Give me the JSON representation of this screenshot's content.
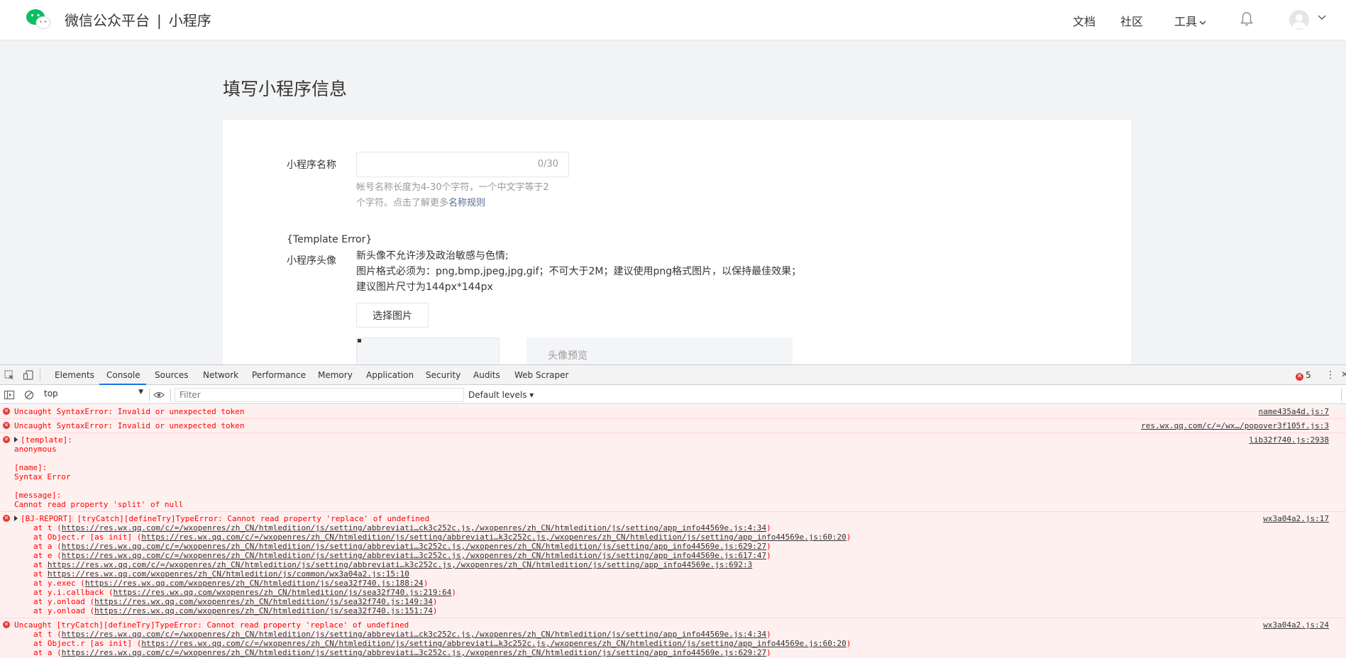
{
  "header": {
    "brand": "微信公众平台",
    "separator": "|",
    "product": "小程序",
    "nav": [
      "文档",
      "社区",
      "工具"
    ],
    "brand_color": "#07c160"
  },
  "page": {
    "title": "填写小程序信息",
    "name_field": {
      "label": "小程序名称",
      "value": "",
      "counter": "0/30",
      "tip_line1": "帐号名称长度为4-30个字符，一个中文字等于2",
      "tip_line2": "个字符。点击了解更多",
      "tip_link": "名称规则"
    },
    "template_error": "{Template Error}",
    "avatar_field": {
      "label": "小程序头像",
      "desc": [
        "新头像不允许涉及政治敏感与色情;",
        "图片格式必须为：png,bmp,jpeg,jpg,gif；不可大于2M；建议使用png格式图片，以保持最佳效果；",
        "建议图片尺寸为144px*144px"
      ],
      "choose_button": "选择图片",
      "preview_label": "头像预览"
    }
  },
  "devtools": {
    "tabs": [
      "Elements",
      "Console",
      "Sources",
      "Network",
      "Performance",
      "Memory",
      "Application",
      "Security",
      "Audits",
      "Web Scraper"
    ],
    "active_tab": "Console",
    "error_count": "5",
    "context": "top",
    "filter_placeholder": "Filter",
    "levels": "Default levels",
    "messages": [
      {
        "text": "Uncaught SyntaxError: Invalid or unexpected token",
        "source": "name435a4d.js:7"
      },
      {
        "text": "Uncaught SyntaxError: Invalid or unexpected token",
        "source": "res.wx.qq.com/c/=/wx…/popover3f105f.js:3"
      },
      {
        "text": "[template]:",
        "source": "lib32f740.js:2938",
        "extra": [
          "anonymous",
          "",
          "[name]:",
          "Syntax Error",
          "",
          "[message]:",
          "Cannot read property 'split' of null"
        ]
      },
      {
        "text": "[BJ-REPORT] [tryCatch][defineTry]TypeError: Cannot read property 'replace' of undefined",
        "source": "wx3a04a2.js:17",
        "stack": [
          {
            "pre": "at t (",
            "url": "https://res.wx.qq.com/c/=/wxopenres/zh_CN/htmledition/js/setting/abbreviati…ck3c252c.js,/wxopenres/zh_CN/htmledition/js/setting/app_info44569e.js:4:34",
            "post": ")"
          },
          {
            "pre": "at Object.r [as init] (",
            "url": "https://res.wx.qq.com/c/=/wxopenres/zh_CN/htmledition/js/setting/abbreviati…k3c252c.js,/wxopenres/zh_CN/htmledition/js/setting/app_info44569e.js:60:20",
            "post": ")"
          },
          {
            "pre": "at a (",
            "url": "https://res.wx.qq.com/c/=/wxopenres/zh_CN/htmledition/js/setting/abbreviati…3c252c.js,/wxopenres/zh_CN/htmledition/js/setting/app_info44569e.js:629:27",
            "post": ")"
          },
          {
            "pre": "at e (",
            "url": "https://res.wx.qq.com/c/=/wxopenres/zh_CN/htmledition/js/setting/abbreviati…3c252c.js,/wxopenres/zh_CN/htmledition/js/setting/app_info44569e.js:617:47",
            "post": ")"
          },
          {
            "pre": "at ",
            "url": "https://res.wx.qq.com/c/=/wxopenres/zh_CN/htmledition/js/setting/abbreviati…k3c252c.js,/wxopenres/zh_CN/htmledition/js/setting/app_info44569e.js:692:3",
            "post": ""
          },
          {
            "pre": "at ",
            "url": "https://res.wx.qq.com/wxopenres/zh_CN/htmledition/js/common/wx3a04a2.js:15:10",
            "post": ""
          },
          {
            "pre": "at y.exec (",
            "url": "https://res.wx.qq.com/wxopenres/zh_CN/htmledition/js/sea32f740.js:188:24",
            "post": ")"
          },
          {
            "pre": "at y.i.callback (",
            "url": "https://res.wx.qq.com/wxopenres/zh_CN/htmledition/js/sea32f740.js:219:64",
            "post": ")"
          },
          {
            "pre": "at y.onload (",
            "url": "https://res.wx.qq.com/wxopenres/zh_CN/htmledition/js/sea32f740.js:149:34",
            "post": ")"
          },
          {
            "pre": "at y.onload (",
            "url": "https://res.wx.qq.com/wxopenres/zh_CN/htmledition/js/sea32f740.js:151:74",
            "post": ")"
          }
        ]
      },
      {
        "text": "Uncaught [tryCatch][defineTry]TypeError: Cannot read property 'replace' of undefined",
        "source": "wx3a04a2.js:24",
        "stack": [
          {
            "pre": "at t (",
            "url": "https://res.wx.qq.com/c/=/wxopenres/zh_CN/htmledition/js/setting/abbreviati…ck3c252c.js,/wxopenres/zh_CN/htmledition/js/setting/app_info44569e.js:4:34",
            "post": ")"
          },
          {
            "pre": "at Object.r [as init] (",
            "url": "https://res.wx.qq.com/c/=/wxopenres/zh_CN/htmledition/js/setting/abbreviati…k3c252c.js,/wxopenres/zh_CN/htmledition/js/setting/app_info44569e.js:60:20",
            "post": ")"
          },
          {
            "pre": "at a (",
            "url": "https://res.wx.qq.com/c/=/wxopenres/zh_CN/htmledition/js/setting/abbreviati…3c252c.js,/wxopenres/zh_CN/htmledition/js/setting/app_info44569e.js:629:27",
            "post": ")"
          }
        ]
      }
    ]
  }
}
